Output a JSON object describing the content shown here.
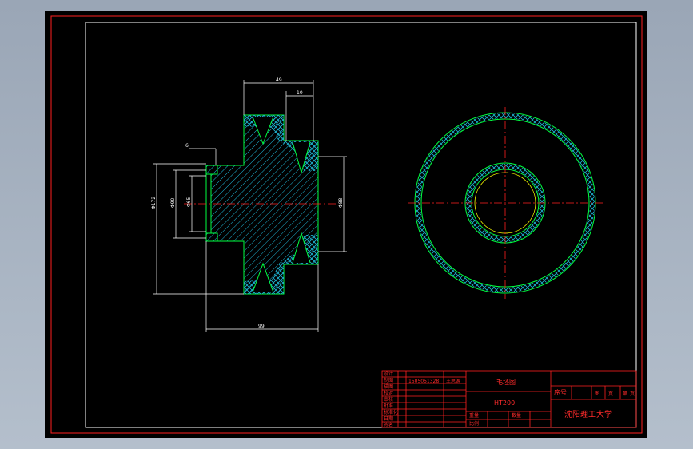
{
  "colors": {
    "background": "#000000",
    "frame_outer": "#ff2020",
    "frame_inner": "#ffffff",
    "outline": "#00ff40",
    "hatch": "#1fb8d8",
    "centerline": "#ff2020",
    "dimension": "#ffffff",
    "pitch_circle": "#ffff00",
    "title_block": "#ff2020"
  },
  "dimensions": {
    "top_width": "49",
    "top_groove": "10",
    "left_step": "6",
    "dia_outer": "Φ172",
    "dia_mid": "Φ90",
    "dia_bore": "Φ65",
    "dia_right": "Φ88",
    "bottom_length": "99"
  },
  "title_block": {
    "part_name": "毛坯图",
    "material": "HT200",
    "school": "沈阳理工大学",
    "student_id": "1505051328",
    "student_name": "王思源",
    "seq_label": "序号",
    "row_labels": [
      "设计",
      "制图",
      "描图",
      "校对",
      "审核",
      "批准",
      "标准化",
      "日期",
      "签名"
    ],
    "scale_labels": [
      "重量",
      "比例",
      "数量",
      "共",
      "页",
      "第",
      "页"
    ],
    "small_labels": [
      "图",
      "页",
      "第",
      "页"
    ]
  }
}
